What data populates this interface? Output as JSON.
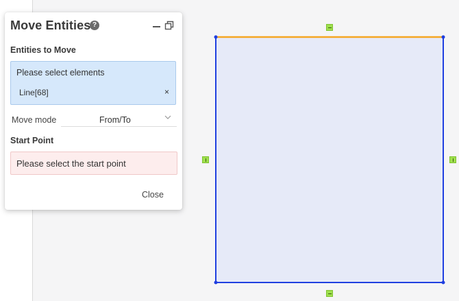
{
  "panel": {
    "title": "Move Entities",
    "help_icon": "help-circle-icon",
    "minimize_icon": "minimize-icon",
    "restore_icon": "restore-window-icon",
    "entities_label": "Entities to Move",
    "entities_prompt": "Please select elements",
    "selected_entity": "Line[68]",
    "remove_glyph": "×",
    "move_mode_label": "Move mode",
    "move_mode_value": "From/To",
    "start_point_label": "Start Point",
    "start_point_prompt": "Please select the start point",
    "close_label": "Close"
  },
  "canvas": {
    "shape_fill": "#e6eaf8",
    "shape_stroke": "#1f3fe0",
    "selected_edge_color": "#f5a623",
    "constraint_marker_color": "#9fe04e",
    "horizontal_marker_glyph": "—",
    "vertical_marker_glyph": "|"
  }
}
